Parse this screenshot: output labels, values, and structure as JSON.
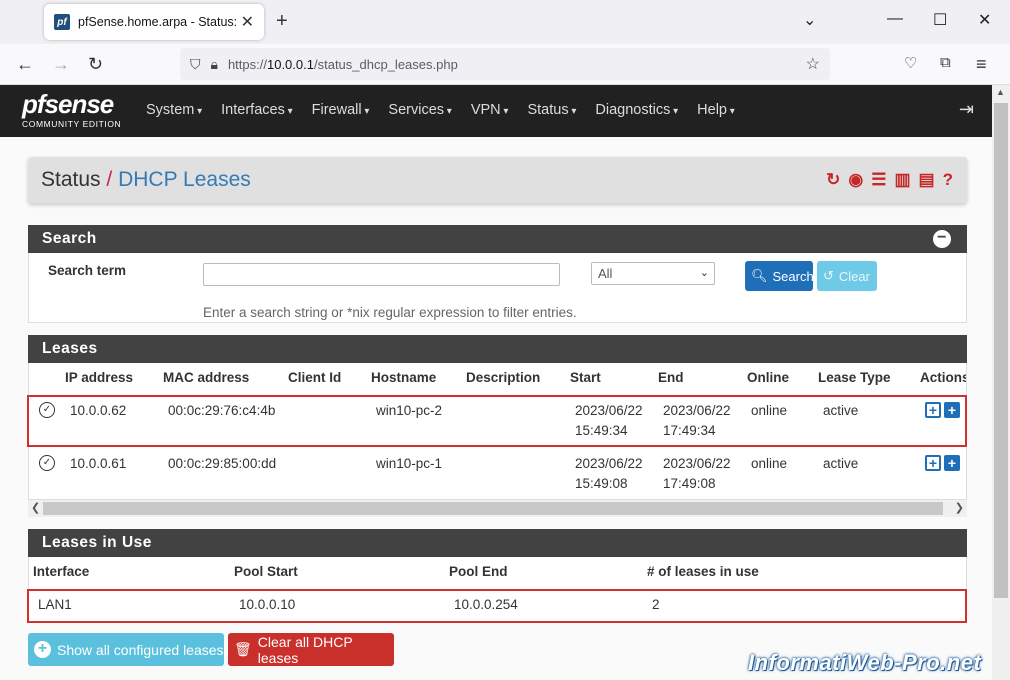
{
  "browser": {
    "tab_title": "pfSense.home.arpa - Status: DH",
    "url_prefix": "https://",
    "url_host": "10.0.0.1",
    "url_path": "/status_dhcp_leases.php"
  },
  "header": {
    "logo": "pfsense",
    "edition": "COMMUNITY EDITION",
    "menu": [
      "System",
      "Interfaces",
      "Firewall",
      "Services",
      "VPN",
      "Status",
      "Diagnostics",
      "Help"
    ]
  },
  "breadcrumb": {
    "section": "Status",
    "separator": "/",
    "page": "DHCP Leases"
  },
  "search": {
    "panel_title": "Search",
    "term_label": "Search term",
    "select_value": "All",
    "search_button": "Search",
    "clear_button": "Clear",
    "help": "Enter a search string or *nix regular expression to filter entries."
  },
  "leases": {
    "panel_title": "Leases",
    "columns": [
      "IP address",
      "MAC address",
      "Client Id",
      "Hostname",
      "Description",
      "Start",
      "End",
      "Online",
      "Lease Type",
      "Actions"
    ],
    "rows": [
      {
        "ip": "10.0.0.62",
        "mac": "00:0c:29:76:c4:4b",
        "client_id": "",
        "hostname": "win10-pc-2",
        "description": "",
        "start_date": "2023/06/22",
        "start_time": "15:49:34",
        "end_date": "2023/06/22",
        "end_time": "17:49:34",
        "online": "online",
        "type": "active"
      },
      {
        "ip": "10.0.0.61",
        "mac": "00:0c:29:85:00:dd",
        "client_id": "",
        "hostname": "win10-pc-1",
        "description": "",
        "start_date": "2023/06/22",
        "start_time": "15:49:08",
        "end_date": "2023/06/22",
        "end_time": "17:49:08",
        "online": "online",
        "type": "active"
      }
    ]
  },
  "in_use": {
    "panel_title": "Leases in Use",
    "columns": [
      "Interface",
      "Pool Start",
      "Pool End",
      "# of leases in use"
    ],
    "rows": [
      {
        "interface": "LAN1",
        "pool_start": "10.0.0.10",
        "pool_end": "10.0.0.254",
        "count": "2"
      }
    ]
  },
  "buttons": {
    "show_all": "Show all configured leases",
    "clear_all": "Clear all DHCP leases"
  },
  "watermark": "InformatiWeb-Pro.net",
  "colors": {
    "header_bg": "#212121",
    "panel_head": "#424242",
    "accent_red": "#c62828",
    "link_blue": "#337ab7",
    "highlight": "#d32f2f"
  }
}
